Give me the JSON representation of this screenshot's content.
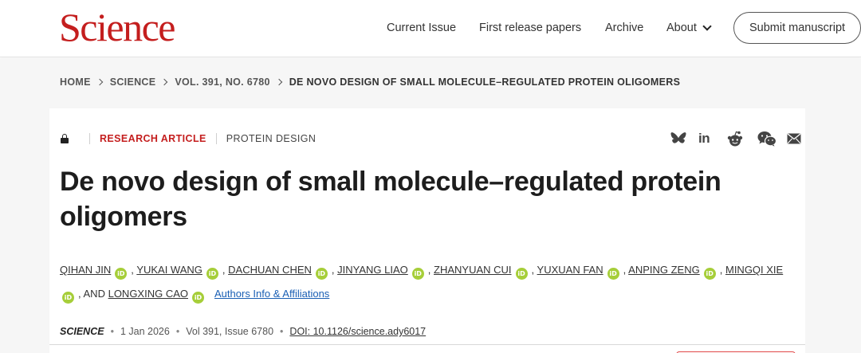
{
  "header": {
    "logo": "Science",
    "nav": [
      "Current Issue",
      "First release papers",
      "Archive"
    ],
    "about_label": "About",
    "submit_label": "Submit manuscript"
  },
  "breadcrumb": [
    "HOME",
    "SCIENCE",
    "VOL. 391, NO. 6780",
    "DE NOVO DESIGN OF SMALL MOLECULE–REGULATED PROTEIN OLIGOMERS"
  ],
  "article": {
    "type": "RESEARCH ARTICLE",
    "subject": "PROTEIN DESIGN",
    "title": "De novo design of small molecule–regulated protein oligomers",
    "authors": [
      "QIHAN JIN",
      "YUKAI WANG",
      "DACHUAN CHEN",
      "JINYANG LIAO",
      "ZHANYUAN CUI",
      "YUXUAN FAN",
      "ANPING ZENG",
      "MINGQI XIE",
      "LONGXING CAO"
    ],
    "and_label": ", AND",
    "comma": ",",
    "orcid_label": "iD",
    "affiliations_link": "Authors Info & Affiliations"
  },
  "citation": {
    "journal": "SCIENCE",
    "date": "1 Jan 2026",
    "volume_issue": "Vol 391, Issue 6780",
    "doi": "DOI: 10.1126/science.ady6017",
    "separator": "•"
  },
  "share_icons": [
    "bluesky-icon",
    "linkedin-icon",
    "reddit-icon",
    "wechat-icon",
    "email-icon"
  ],
  "share_linkedin_text": "in",
  "colors": {
    "brand_red": "#c41e1e",
    "orcid_green": "#a6ce39",
    "link_blue": "#1a5fb4",
    "band_gray": "#f6f6f6"
  }
}
